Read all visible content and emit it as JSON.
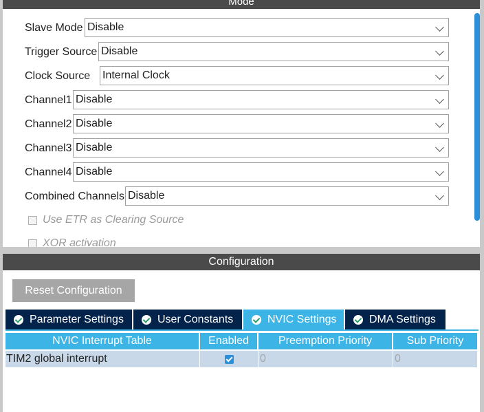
{
  "mode": {
    "header": "Mode",
    "fields": [
      {
        "label": "Slave Mode",
        "value": "Disable"
      },
      {
        "label": "Trigger Source",
        "value": "Disable"
      },
      {
        "label": "Clock Source",
        "value": "Internal Clock"
      },
      {
        "label": "Channel1",
        "value": "Disable"
      },
      {
        "label": "Channel2",
        "value": "Disable"
      },
      {
        "label": "Channel3",
        "value": "Disable"
      },
      {
        "label": "Channel4",
        "value": "Disable"
      },
      {
        "label": "Combined Channels",
        "value": "Disable"
      }
    ],
    "checkboxes": [
      {
        "label": "Use ETR as Clearing Source",
        "checked": false
      },
      {
        "label": "XOR activation",
        "checked": false
      }
    ]
  },
  "configuration": {
    "header": "Configuration",
    "reset_label": "Reset Configuration",
    "tabs": [
      {
        "label": "Parameter Settings",
        "active": false
      },
      {
        "label": "User Constants",
        "active": false
      },
      {
        "label": "NVIC Settings",
        "active": true
      },
      {
        "label": "DMA Settings",
        "active": false
      }
    ],
    "table": {
      "columns": [
        "NVIC Interrupt Table",
        "Enabled",
        "Preemption Priority",
        "Sub Priority"
      ],
      "rows": [
        {
          "name": "TIM2 global interrupt",
          "enabled": true,
          "preemption": "0",
          "sub": "0"
        }
      ]
    }
  },
  "colors": {
    "accent": "#3cb4e6",
    "tab_dark": "#03234b",
    "header_bg": "#4a4a4a",
    "scrollbar": "#2b8fd9"
  }
}
